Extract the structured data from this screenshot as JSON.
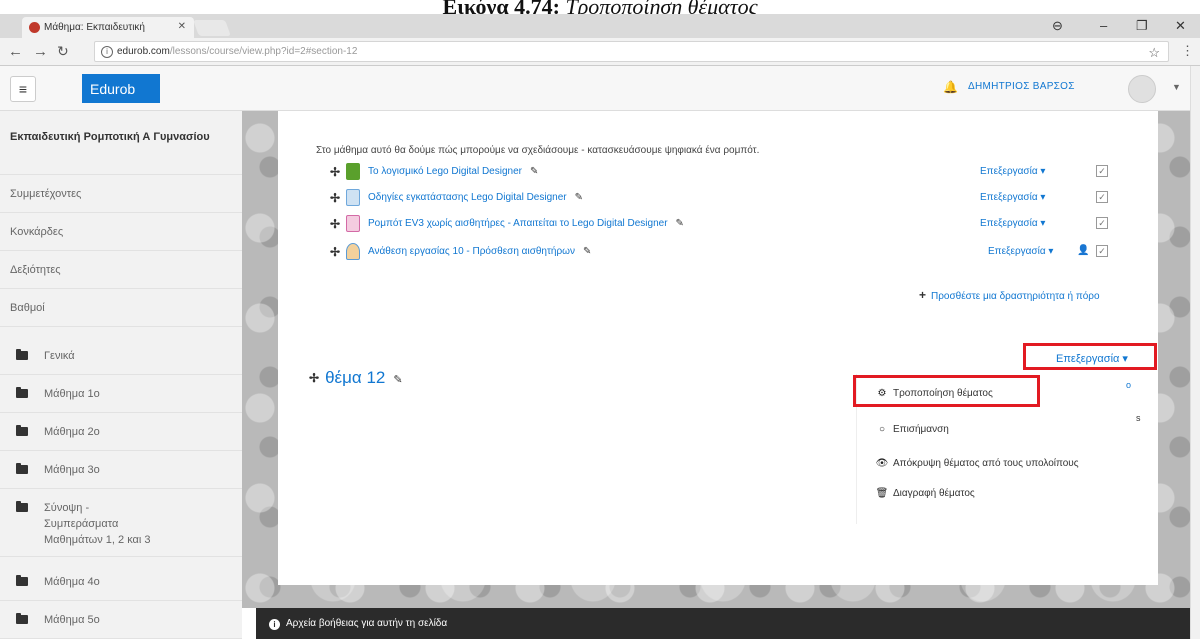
{
  "caption": {
    "label": "Εικόνα 4.74:",
    "text": "Τροποποίηση θέματος"
  },
  "browser": {
    "tab_title": "Μάθημα: Εκπαιδευτική",
    "url_host": "edurob.com",
    "url_path": "/lessons/course/view.php?id=2#section-12"
  },
  "navbar": {
    "brand": "Edurob",
    "user_name": "ΔΗΜΗΤΡΙΟΣ ΒΑΡΣΟΣ"
  },
  "sidebar": {
    "course_title": "Εκπαιδευτική Ρομποτική Α Γυμνασίου",
    "links": [
      "Συμμετέχοντες",
      "Κονκάρδες",
      "Δεξιότητες",
      "Βαθμοί"
    ],
    "sections": [
      "Γενικά",
      "Μάθημα 1ο",
      "Μάθημα 2ο",
      "Μάθημα 3ο",
      "Σύνοψη - Συμπεράσματα Μαθημάτων 1, 2 και 3",
      "Μάθημα 4ο",
      "Μάθημα 5ο"
    ]
  },
  "content": {
    "intro": "Στο μάθημα αυτό θα δούμε πώς μπορούμε να σχεδιάσουμε - κατασκευάσουμε ψηφιακά ένα ρομπότ.",
    "edit_label": "Επεξεργασία",
    "activities": [
      {
        "title": "Το λογισμικό Lego Digital Designer",
        "icon": "book-icon",
        "color": "#5aa02c"
      },
      {
        "title": "Οδηγίες εγκατάστασης Lego Digital Designer",
        "icon": "page-icon",
        "color": "#6fa8dc"
      },
      {
        "title": "Ρομπότ EV3 χωρίς αισθητήρες - Απαιτείται το Lego Digital Designer",
        "icon": "file-icon",
        "color": "#d36aa6"
      },
      {
        "title": "Ανάθεση εργασίας 10 - Πρόσθεση αισθητήρων",
        "icon": "assignment-icon",
        "color": "#5b9bd5"
      }
    ],
    "add_activity": "Προσθέστε μια δραστηριότητα ή πόρο",
    "section_title": "θέμα 12",
    "section_edit_label": "Επεξεργασία",
    "menu": [
      {
        "label": "Τροποποίηση θέματος",
        "icon": "gear-icon"
      },
      {
        "label": "Επισήμανση",
        "icon": "highlight-icon"
      },
      {
        "label": "Απόκρυψη θέματος από τους υπολοίπους",
        "icon": "eye-icon"
      },
      {
        "label": "Διαγραφή θέματος",
        "icon": "trash-icon"
      }
    ],
    "stray_o": "o",
    "stray_s": "s"
  },
  "footer": {
    "help_link": "Αρχεία βοήθειας για αυτήν τη σελίδα"
  }
}
